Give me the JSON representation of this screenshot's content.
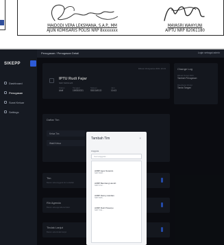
{
  "signatures": {
    "left": {
      "name": "MAIDODI VERA LEKSMANA, S.A.P., MM",
      "rank": "AJUN KOMISARIS POLISI NRP 8xxxxxxx"
    },
    "right": {
      "name": "MAYASRI WAHYUNI",
      "rank": "AIPTU NRP 82061180"
    }
  },
  "app": {
    "brand": "SIKEPP",
    "nav": [
      {
        "label": "Dashboard"
      },
      {
        "label": "Penugasan"
      },
      {
        "label": "Surat Keluar"
      },
      {
        "label": "Settings"
      }
    ],
    "topbar_title": "Penugasan / Penugasan Detail",
    "topbar_user": "Login sebagai admin",
    "main": {
      "date": "Dibuat 19 Agustus 2021 10:43",
      "name": "IPTU Rudi Fajar",
      "nrp": "NRP 82061125",
      "meta": [
        {
          "label": "Status",
          "value": "Aktif"
        },
        {
          "label": "Tanggal",
          "value": "19/08/2021"
        },
        {
          "label": "Satuan",
          "value": "SIDOARJO"
        },
        {
          "label": "Jam",
          "value": "10:43"
        }
      ]
    },
    "side": {
      "title": "Change Log",
      "items": [
        {
          "label": "Dibuat 19 Agt 2021",
          "value": "Tambah Penugasan"
        },
        {
          "label": "Diperbarui 19 Agt",
          "value": "Tanda Tangan"
        }
      ]
    },
    "section": {
      "title": "Daftar Tim",
      "rows": [
        {
          "label": "Ketua Tim",
          "sub": "NRP 1"
        },
        {
          "label": "Wakil Ketua",
          "sub": "NRP 2"
        }
      ]
    },
    "tasks": [
      {
        "title": "Tim",
        "sub": "Belum ada anggota tim terdaftar"
      },
      {
        "title": "Rin Agenda",
        "sub": "Belum ada agenda tercatat"
      },
      {
        "title": "Tindak Lanjut",
        "sub": "Belum ada tindak lanjut"
      }
    ],
    "modal": {
      "title": "Tambah Tim",
      "close": "×",
      "label": "Anggota",
      "placeholder": "Cari anggota...",
      "options": [
        {
          "name": "AKBP Agus Susanto",
          "sub": "NRP 6508..."
        },
        {
          "name": "AKBP Bambang Hendri",
          "sub": "NRP 6712..."
        },
        {
          "name": "AKBP Danny Hardian",
          "sub": "NRP 6905..."
        },
        {
          "name": "AKBP Rudi Prasetyo",
          "sub": "NRP 7011..."
        }
      ]
    }
  },
  "colors": {
    "accent": "#2f63e0",
    "dark_bg": "#0f1117",
    "card_bg": "#1b1f29"
  }
}
